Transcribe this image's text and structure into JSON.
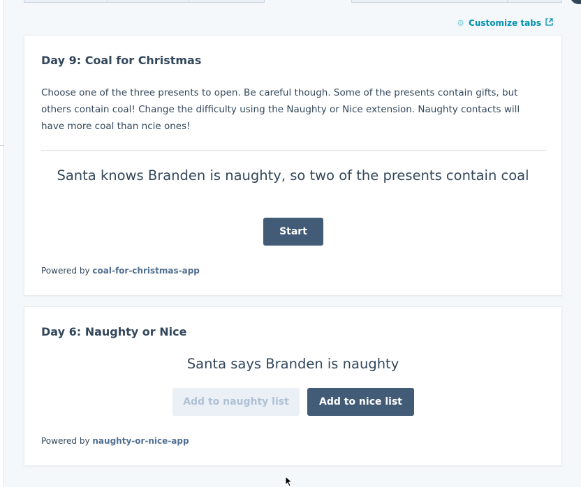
{
  "header": {
    "customize_tabs_label": "Customize tabs",
    "customize_icon": "gear-icon",
    "external_icon": "external-link-icon"
  },
  "cards": [
    {
      "title": "Day 9: Coal for Christmas",
      "description": "Choose one of the three presents to open. Be careful though. Some of the presents contain gifts, but others contain coal! Change the difficulty using the Naughty or Nice extension. Naughty contacts will have more coal than ncie ones!",
      "headline": "Santa knows Branden is naughty, so two of the presents contain coal",
      "start_label": "Start",
      "powered_prefix": "Powered by",
      "powered_app": "coal-for-christmas-app"
    },
    {
      "title": "Day 6: Naughty or Nice",
      "headline": "Santa says Branden is naughty",
      "naughty_label": "Add to naughty list",
      "nice_label": "Add to nice list",
      "powered_prefix": "Powered by",
      "powered_app": "naughty-or-nice-app"
    }
  ],
  "colors": {
    "accent_link": "#0091ae",
    "primary_button": "#425b76",
    "disabled_button": "#eaf0f6",
    "text": "#33475b"
  }
}
